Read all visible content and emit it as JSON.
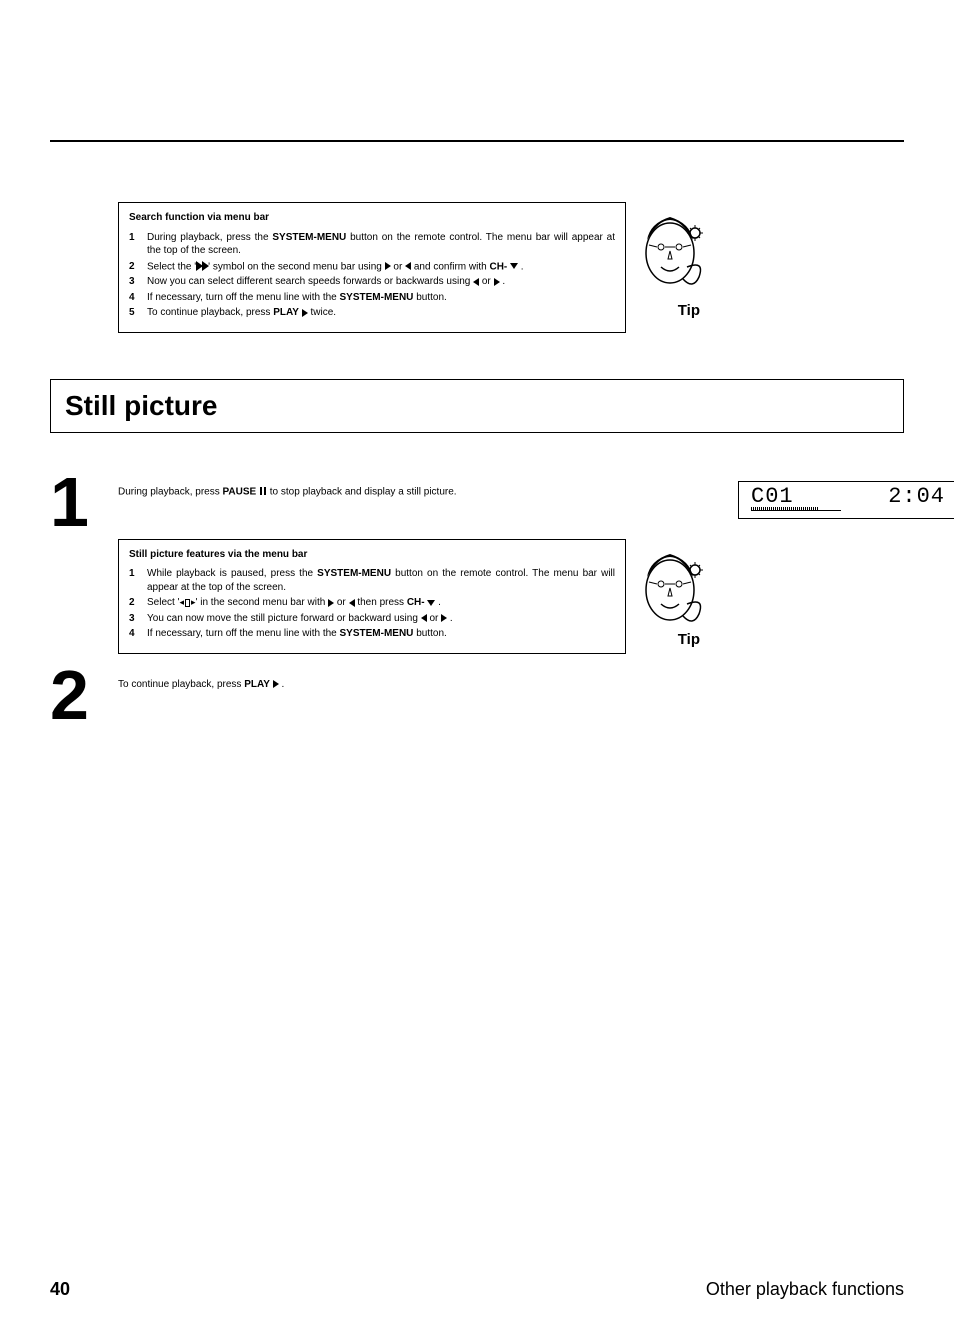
{
  "tip1": {
    "title": "Search function via menu bar",
    "items": [
      "During playback, press the <b>SYSTEM-MENU</b> button on the remote control. The menu bar will appear at the top of the screen.",
      "Select the '<span class=\"ff-sym\"><span class=\"tri-r\"></span><span class=\"tri-r\"></span></span>' symbol on the second menu bar using <span class=\"tri-r\"></span> or <span class=\"tri-l\"></span> and confirm with <b>CH-</b> <span class=\"tri-d\"></span> .",
      "Now you can select different search speeds forwards or backwards using <span class=\"tri-l\"></span> or <span class=\"tri-r\"></span> .",
      "If necessary, turn off the menu line with the <b>SYSTEM-MENU</b> button.",
      "To continue playback, press <b>PLAY</b> <span class=\"tri-r\"></span> twice."
    ],
    "tipLabel": "Tip"
  },
  "sectionHeading": "Still picture",
  "step1": {
    "num": "1",
    "text": "During playback, press <b>PAUSE</b> <span class=\"pause-sym\"><span></span><span></span></span> to stop playback and display a still picture."
  },
  "lcd": {
    "left": "C01",
    "right": "2:04"
  },
  "tip2": {
    "title": "Still picture features via the menu bar",
    "items": [
      "While playback is paused, press the <b>SYSTEM-MENU</b> button on the remote control. The menu bar will appear at the top of the screen.",
      "Select '<span class=\"frame-sym\">◂<span class=\"box\"></span>▸</span>' in the second menu bar with <span class=\"tri-r\"></span> or <span class=\"tri-l\"></span> then press <b>CH-</b> <span class=\"tri-d\"></span> .",
      "You can now move the still picture forward or backward using <span class=\"tri-l\"></span> or <span class=\"tri-r\"></span> .",
      "If necessary, turn off the menu line with the <b>SYSTEM-MENU</b> button."
    ],
    "tipLabel": "Tip"
  },
  "step2": {
    "num": "2",
    "text": "To continue playback, press <b>PLAY</b> <span class=\"tri-r\"></span> ."
  },
  "footer": {
    "pageNum": "40",
    "title": "Other playback functions"
  }
}
